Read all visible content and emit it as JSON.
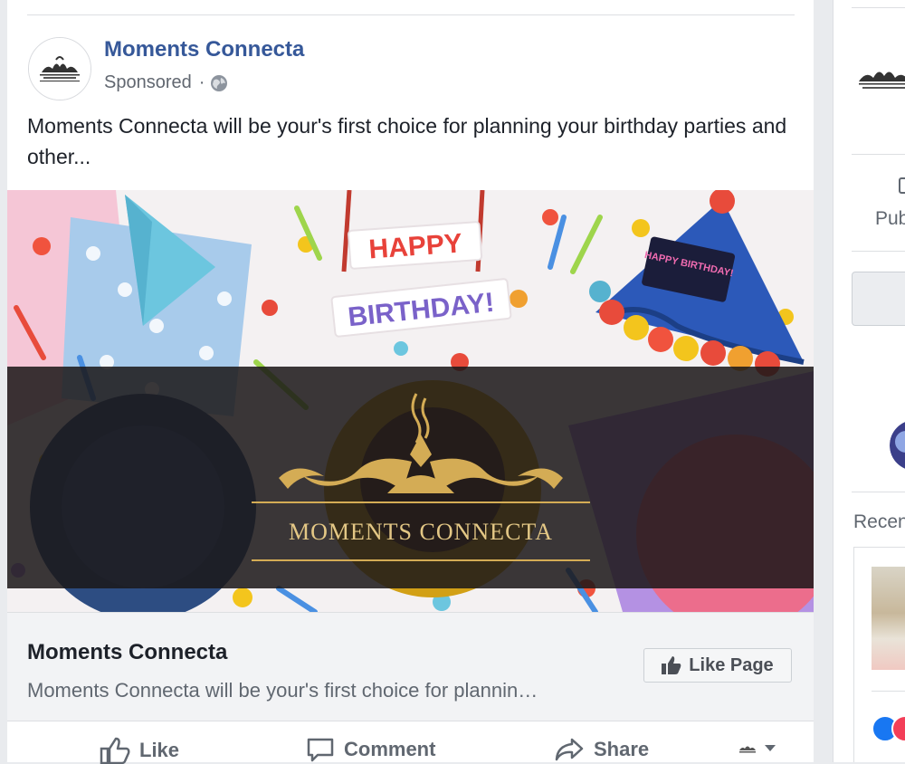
{
  "post": {
    "page_name": "Moments Connecta",
    "sponsored": "Sponsored",
    "separator": "·",
    "privacy_icon": "globe-icon",
    "text": "Moments Connecta will be your's first choice for planning your birthday parties and other..."
  },
  "banner": {
    "banner_top_text": "HAPPY",
    "banner_bottom_text": "BIRTHDAY!",
    "hat_text": "HAPPY BIRTHDAY!",
    "brand_wordmark": "MOMENTS CONNECTA",
    "colors": {
      "overlay": "#1b1718",
      "gold": "#d4ac55"
    }
  },
  "link_preview": {
    "title": "Moments Connecta",
    "description": "Moments Connecta will be your's first choice for plannin…",
    "like_page_label": "Like Page",
    "like_page_icon": "thumbs-up-icon"
  },
  "actions": {
    "like_label": "Like",
    "comment_label": "Comment",
    "share_label": "Share",
    "more_icon": "chevron-down-icon"
  },
  "sidebar": {
    "public_label": "Pub",
    "recent_label": "Recen"
  },
  "colors": {
    "link_blue": "#365899",
    "text_dark": "#1d2129",
    "text_grey": "#606770",
    "page_bg": "#e9ebee",
    "footer_bg": "#f2f3f5"
  }
}
